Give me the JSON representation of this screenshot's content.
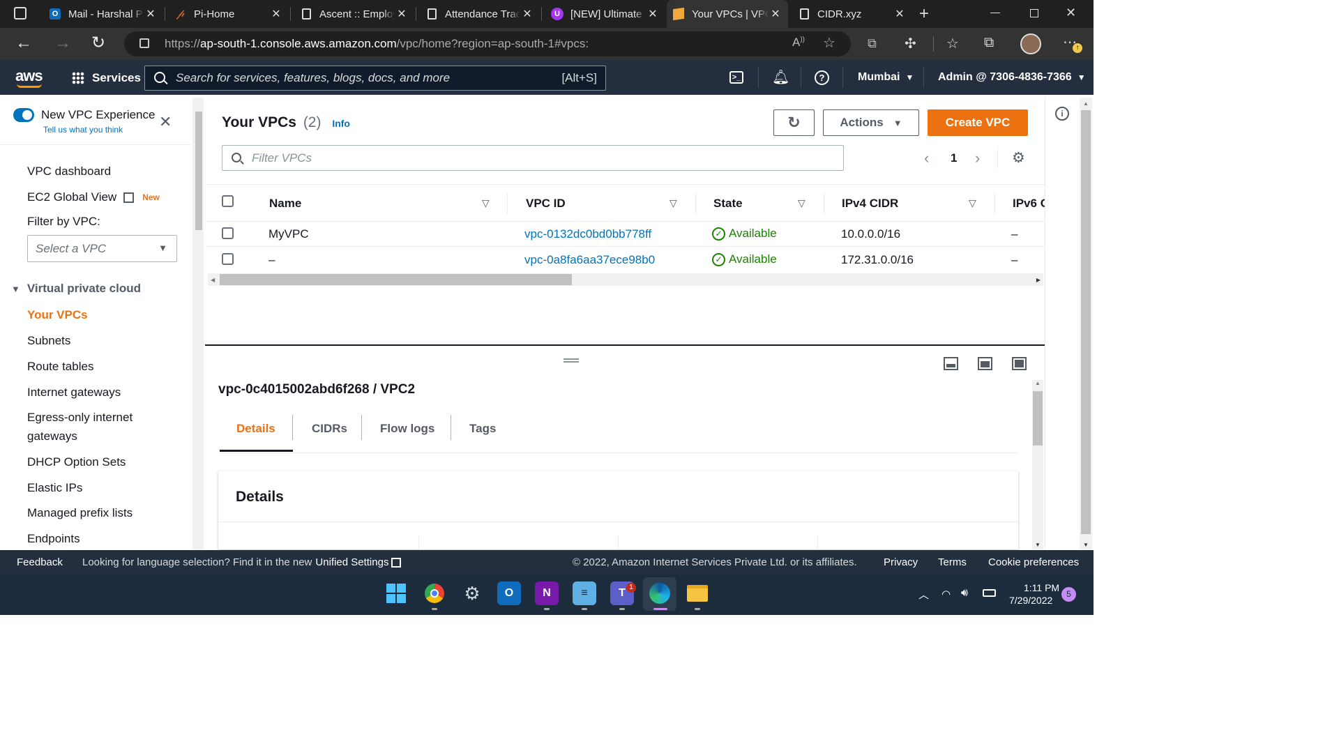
{
  "browser": {
    "tabs": [
      {
        "title": "Mail - Harshal Patil - Outlook",
        "icon": "outlook-icon",
        "icon_color": "#0f6cbd"
      },
      {
        "title": "Pi-Home",
        "icon": "pi-icon",
        "icon_color": "#e86a36"
      },
      {
        "title": "Ascent :: Employee Portal",
        "icon": "page-icon",
        "icon_color": "#ddd"
      },
      {
        "title": "Attendance Tracker",
        "icon": "page-icon",
        "icon_color": "#ddd"
      },
      {
        "title": "[NEW] Ultimate AWS Certified",
        "icon": "udemy-icon",
        "icon_color": "#a435f0"
      },
      {
        "title": "Your VPCs | VPC Management Console",
        "icon": "aws-cube-icon",
        "icon_color": "#f2a93b"
      },
      {
        "title": "CIDR.xyz",
        "icon": "page-icon",
        "icon_color": "#ddd"
      }
    ],
    "url_prefix": "https://",
    "url_host": "ap-south-1.console.aws.amazon.com",
    "url_path": "/vpc/home?region=ap-south-1#vpcs:"
  },
  "aws_header": {
    "logo": "aws",
    "services_label": "Services",
    "search_placeholder": "Search for services, features, blogs, docs, and more",
    "search_shortcut": "[Alt+S]",
    "region": "Mumbai",
    "account": "Admin @ 7306-4836-7366"
  },
  "sidebar": {
    "toggle_label": "New VPC Experience",
    "toggle_sub": "Tell us what you think",
    "dashboard": "VPC dashboard",
    "ec2_global": "EC2 Global View",
    "ec2_badge": "New",
    "filter_label": "Filter by VPC:",
    "filter_placeholder": "Select a VPC",
    "section": "Virtual private cloud",
    "items": [
      "Your VPCs",
      "Subnets",
      "Route tables",
      "Internet gateways",
      "Egress-only internet",
      "gateways",
      "DHCP Option Sets",
      "Elastic IPs",
      "Managed prefix lists",
      "Endpoints"
    ]
  },
  "main": {
    "title": "Your VPCs",
    "count": "(2)",
    "info": "Info",
    "actions": "Actions",
    "create": "Create VPC",
    "filter_placeholder": "Filter VPCs",
    "page": "1",
    "columns": [
      "Name",
      "VPC ID",
      "State",
      "IPv4 CIDR",
      "IPv6 C"
    ],
    "rows": [
      {
        "name": "MyVPC",
        "vpc_id": "vpc-0132dc0bd0bb778ff",
        "state": "Available",
        "ipv4": "10.0.0.0/16",
        "ipv6": "–"
      },
      {
        "name": "–",
        "vpc_id": "vpc-0a8fa6aa37ece98b0",
        "state": "Available",
        "ipv4": "172.31.0.0/16",
        "ipv6": "–"
      }
    ],
    "detail_title": "vpc-0c4015002abd6f268 / VPC2",
    "detail_tabs": [
      "Details",
      "CIDRs",
      "Flow logs",
      "Tags"
    ],
    "details_heading": "Details"
  },
  "footer": {
    "feedback": "Feedback",
    "lang_msg": "Looking for language selection? Find it in the new",
    "unified": "Unified Settings",
    "copyright": "© 2022, Amazon Internet Services Private Ltd. or its affiliates.",
    "privacy": "Privacy",
    "terms": "Terms",
    "cookies": "Cookie preferences"
  },
  "taskbar": {
    "time": "1:11 PM",
    "date": "7/29/2022",
    "notif_count": "5",
    "teams_badge": "1"
  }
}
